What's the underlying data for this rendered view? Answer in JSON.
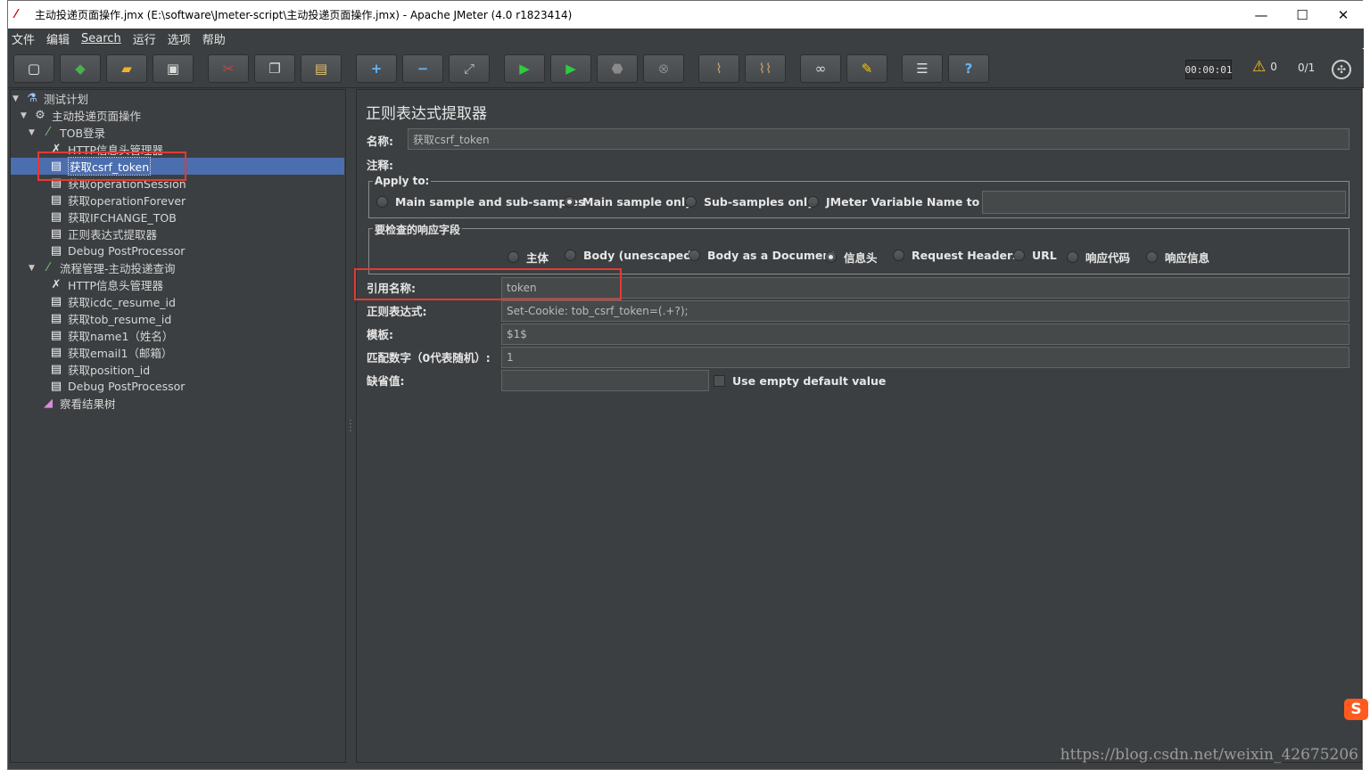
{
  "window": {
    "title": "主动投递页面操作.jmx (E:\\software\\Jmeter-script\\主动投递页面操作.jmx) - Apache JMeter (4.0 r1823414)",
    "minimize": "—",
    "maximize": "☐",
    "close": "✕"
  },
  "menu": [
    "文件",
    "编辑",
    "Search",
    "运行",
    "选项",
    "帮助"
  ],
  "status": {
    "timer": "00:00:01",
    "warnings": "0",
    "threads": "0/1"
  },
  "tree": [
    {
      "label": "测试计划",
      "icon": "flask-icon"
    },
    {
      "label": "主动投递页面操作",
      "icon": "gear-icon"
    },
    {
      "label": "TOB登录",
      "icon": "pipette-icon"
    },
    {
      "label": "HTTP信息头管理器",
      "icon": "tools-icon"
    },
    {
      "label": "获取csrf_token",
      "icon": "document-icon"
    },
    {
      "label": "获取operationSession",
      "icon": "document-icon"
    },
    {
      "label": "获取operationForever",
      "icon": "document-icon"
    },
    {
      "label": "获取IFCHANGE_TOB",
      "icon": "document-icon"
    },
    {
      "label": "正则表达式提取器",
      "icon": "document-icon"
    },
    {
      "label": "Debug PostProcessor",
      "icon": "document-icon"
    },
    {
      "label": "流程管理-主动投递查询",
      "icon": "pipette-icon"
    },
    {
      "label": "HTTP信息头管理器",
      "icon": "tools-icon"
    },
    {
      "label": "获取icdc_resume_id",
      "icon": "document-icon"
    },
    {
      "label": "获取tob_resume_id",
      "icon": "document-icon"
    },
    {
      "label": "获取name1（姓名）",
      "icon": "document-icon"
    },
    {
      "label": "获取email1（邮箱）",
      "icon": "document-icon"
    },
    {
      "label": "获取position_id",
      "icon": "document-icon"
    },
    {
      "label": "Debug PostProcessor",
      "icon": "document-icon"
    },
    {
      "label": "察看结果树",
      "icon": "chart-icon"
    }
  ],
  "panel": {
    "title": "正则表达式提取器",
    "name_label": "名称:",
    "name_value": "获取csrf_token",
    "comment_label": "注释:",
    "comment_value": "",
    "apply_to": {
      "legend": "Apply to:",
      "options": [
        "Main sample and sub-samples",
        "Main sample only",
        "Sub-samples only",
        "JMeter Variable Name to use"
      ],
      "selected": "Main sample only",
      "variable_value": ""
    },
    "response_field": {
      "legend": "要检查的响应字段",
      "options": [
        "主体",
        "Body (unescaped)",
        "Body as a Document",
        "信息头",
        "Request Headers",
        "URL",
        "响应代码",
        "响应信息"
      ],
      "selected": "信息头"
    },
    "ref_name_label": "引用名称:",
    "ref_name_value": "token",
    "regex_label": "正则表达式:",
    "regex_value": "Set-Cookie: tob_csrf_token=(.+?);",
    "template_label": "模板:",
    "template_value": "$1$",
    "match_no_label": "匹配数字（0代表随机）:",
    "match_no_value": "1",
    "default_label": "缺省值:",
    "default_value": "",
    "use_empty_label": "Use empty default value"
  },
  "watermark": "https://blog.csdn.net/weixin_42675206",
  "colors": {
    "background": "#3c3f41",
    "selection": "#4b6eaf",
    "highlight_box": "#e53935",
    "field": "#45494a"
  }
}
